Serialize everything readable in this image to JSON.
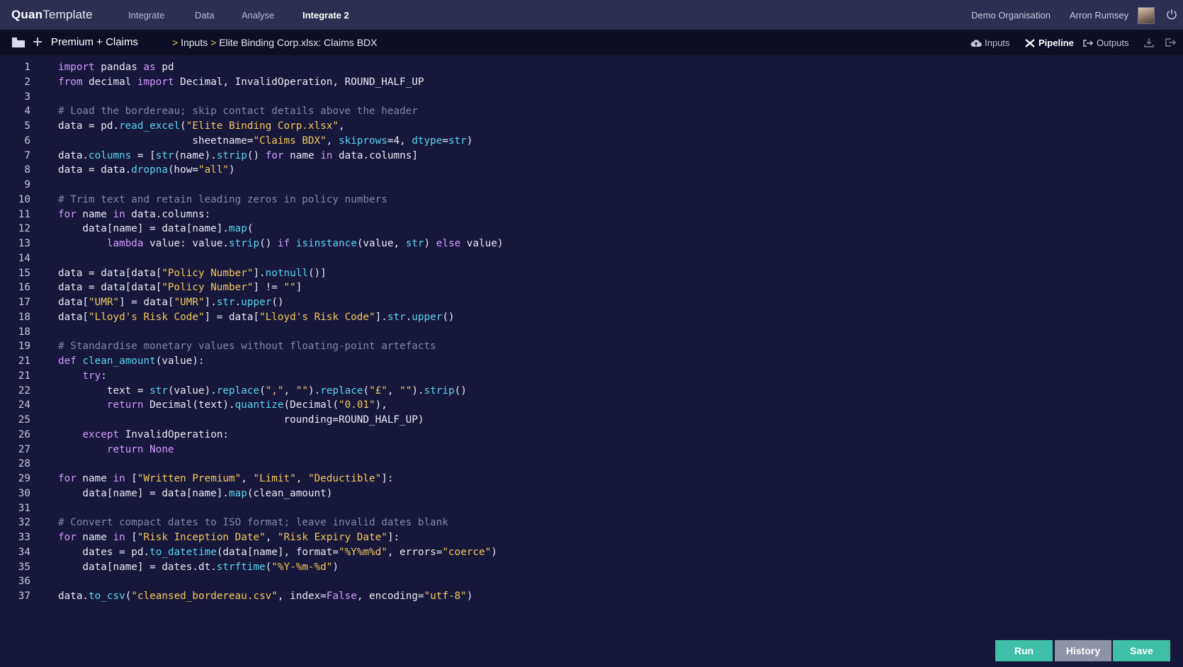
{
  "app": {
    "logo_bold": "Quan",
    "logo_light": "Template",
    "nav": [
      "Integrate",
      "Data",
      "Analyse",
      "Integrate 2"
    ],
    "active_nav": "Integrate 2",
    "organisation": "Demo Organisation",
    "user_name": "Arron Rumsey"
  },
  "subbar": {
    "project": "Premium + Claims",
    "breadcrumb": [
      "Inputs",
      "Elite Binding Corp.xlsx: Claims BDX"
    ],
    "views": [
      "Inputs",
      "Pipeline",
      "Outputs"
    ],
    "active_view": "Pipeline"
  },
  "editor": {
    "lines": [
      {
        "n": "1",
        "code": [
          [
            "kw",
            "import"
          ],
          [
            "t",
            " pandas "
          ],
          [
            "kw",
            "as"
          ],
          [
            "t",
            " pd"
          ]
        ]
      },
      {
        "n": "2",
        "code": [
          [
            "kw",
            "from"
          ],
          [
            "t",
            " decimal "
          ],
          [
            "kw",
            "import"
          ],
          [
            "t",
            " Decimal, InvalidOperation, ROUND_HALF_UP"
          ]
        ]
      },
      {
        "n": "3",
        "code": []
      },
      {
        "n": "4",
        "code": [
          [
            "cm",
            "# Load the bordereau; skip contact details above the header"
          ]
        ]
      },
      {
        "n": "5",
        "code": [
          [
            "t",
            "data = pd."
          ],
          [
            "fn",
            "read_excel"
          ],
          [
            "t",
            "("
          ],
          [
            "str",
            "\"Elite Binding Corp.xlsx\""
          ],
          [
            "t",
            ","
          ]
        ]
      },
      {
        "n": "6",
        "code": [
          [
            "t",
            "                      sheetname="
          ],
          [
            "str",
            "\"Claims BDX\""
          ],
          [
            "t",
            ", "
          ],
          [
            "fn",
            "skiprows"
          ],
          [
            "t",
            "=4, "
          ],
          [
            "fn",
            "dtype"
          ],
          [
            "t",
            "="
          ],
          [
            "fn",
            "str"
          ],
          [
            "t",
            ")"
          ]
        ]
      },
      {
        "n": "7",
        "code": [
          [
            "t",
            "data."
          ],
          [
            "fn",
            "columns"
          ],
          [
            "t",
            " = ["
          ],
          [
            "fn",
            "str"
          ],
          [
            "t",
            "(name)."
          ],
          [
            "fn",
            "strip"
          ],
          [
            "t",
            "() "
          ],
          [
            "kw",
            "for"
          ],
          [
            "t",
            " name "
          ],
          [
            "kw",
            "in"
          ],
          [
            "t",
            " data.columns]"
          ]
        ]
      },
      {
        "n": "8",
        "code": [
          [
            "t",
            "data = data."
          ],
          [
            "fn",
            "dropna"
          ],
          [
            "t",
            "(how="
          ],
          [
            "str",
            "\"all\""
          ],
          [
            "t",
            ")"
          ]
        ]
      },
      {
        "n": "9",
        "code": []
      },
      {
        "n": "10",
        "code": [
          [
            "cm",
            "# Trim text and retain leading zeros in policy numbers"
          ]
        ]
      },
      {
        "n": "11",
        "code": [
          [
            "kw",
            "for"
          ],
          [
            "t",
            " name "
          ],
          [
            "kw",
            "in"
          ],
          [
            "t",
            " data.columns:"
          ]
        ]
      },
      {
        "n": "12",
        "code": [
          [
            "t",
            "    data[name] = data[name]."
          ],
          [
            "fn",
            "map"
          ],
          [
            "t",
            "("
          ]
        ]
      },
      {
        "n": "13",
        "code": [
          [
            "t",
            "        "
          ],
          [
            "kw",
            "lambda"
          ],
          [
            "t",
            " value: value."
          ],
          [
            "fn",
            "strip"
          ],
          [
            "t",
            "() "
          ],
          [
            "kw",
            "if"
          ],
          [
            "t",
            " "
          ],
          [
            "fn",
            "isinstance"
          ],
          [
            "t",
            "(value, "
          ],
          [
            "fn",
            "str"
          ],
          [
            "t",
            ") "
          ],
          [
            "kw",
            "else"
          ],
          [
            "t",
            " value)"
          ]
        ]
      },
      {
        "n": "14",
        "code": []
      },
      {
        "n": "15",
        "code": [
          [
            "t",
            "data = data[data["
          ],
          [
            "str",
            "\"Policy Number\""
          ],
          [
            "t",
            "]."
          ],
          [
            "fn",
            "notnull"
          ],
          [
            "t",
            "()]"
          ]
        ]
      },
      {
        "n": "16",
        "code": [
          [
            "t",
            "data = data[data["
          ],
          [
            "str",
            "\"Policy Number\""
          ],
          [
            "t",
            "] != "
          ],
          [
            "str",
            "\"\""
          ],
          [
            "t",
            "]"
          ]
        ]
      },
      {
        "n": "17",
        "code": [
          [
            "t",
            "data["
          ],
          [
            "str",
            "\"UMR\""
          ],
          [
            "t",
            "] = data["
          ],
          [
            "str",
            "\"UMR\""
          ],
          [
            "t",
            "]."
          ],
          [
            "fn",
            "str"
          ],
          [
            "t",
            "."
          ],
          [
            "fn",
            "upper"
          ],
          [
            "t",
            "()"
          ]
        ]
      },
      {
        "n": "18",
        "code": [
          [
            "t",
            "data["
          ],
          [
            "str",
            "\"Lloyd's Risk Code\""
          ],
          [
            "t",
            "] = data["
          ],
          [
            "str",
            "\"Lloyd's Risk Code\""
          ],
          [
            "t",
            "]."
          ],
          [
            "fn",
            "str"
          ],
          [
            "t",
            "."
          ],
          [
            "fn",
            "upper"
          ],
          [
            "t",
            "()"
          ]
        ]
      },
      {
        "n": "18",
        "code": []
      },
      {
        "n": "19",
        "code": [
          [
            "cm",
            "# Standardise monetary values without floating-point artefacts"
          ]
        ]
      },
      {
        "n": "21",
        "code": [
          [
            "kw",
            "def"
          ],
          [
            "t",
            " "
          ],
          [
            "fn",
            "clean_amount"
          ],
          [
            "t",
            "(value):"
          ]
        ]
      },
      {
        "n": "21",
        "code": [
          [
            "t",
            "    "
          ],
          [
            "kw",
            "try"
          ],
          [
            "t",
            ":"
          ]
        ]
      },
      {
        "n": "22",
        "code": [
          [
            "t",
            "        text = "
          ],
          [
            "fn",
            "str"
          ],
          [
            "t",
            "(value)."
          ],
          [
            "fn",
            "replace"
          ],
          [
            "t",
            "("
          ],
          [
            "str",
            "\",\""
          ],
          [
            "t",
            ", "
          ],
          [
            "str",
            "\"\""
          ],
          [
            "t",
            ")."
          ],
          [
            "fn",
            "replace"
          ],
          [
            "t",
            "("
          ],
          [
            "str",
            "\"£\""
          ],
          [
            "t",
            ", "
          ],
          [
            "str",
            "\"\""
          ],
          [
            "t",
            ")."
          ],
          [
            "fn",
            "strip"
          ],
          [
            "t",
            "()"
          ]
        ]
      },
      {
        "n": "24",
        "code": [
          [
            "t",
            "        "
          ],
          [
            "kw",
            "return"
          ],
          [
            "t",
            " Decimal(text)."
          ],
          [
            "fn",
            "quantize"
          ],
          [
            "t",
            "(Decimal("
          ],
          [
            "str",
            "\"0.01\""
          ],
          [
            "t",
            "),"
          ]
        ]
      },
      {
        "n": "25",
        "code": [
          [
            "t",
            "                                     rounding=ROUND_HALF_UP)"
          ]
        ]
      },
      {
        "n": "26",
        "code": [
          [
            "t",
            "    "
          ],
          [
            "kw",
            "except"
          ],
          [
            "t",
            " InvalidOperation:"
          ]
        ]
      },
      {
        "n": "27",
        "code": [
          [
            "t",
            "        "
          ],
          [
            "kw",
            "return"
          ],
          [
            "t",
            " "
          ],
          [
            "kw",
            "None"
          ]
        ]
      },
      {
        "n": "28",
        "code": []
      },
      {
        "n": "29",
        "code": [
          [
            "kw",
            "for"
          ],
          [
            "t",
            " name "
          ],
          [
            "kw",
            "in"
          ],
          [
            "t",
            " ["
          ],
          [
            "str",
            "\"Written Premium\""
          ],
          [
            "t",
            ", "
          ],
          [
            "str",
            "\"Limit\""
          ],
          [
            "t",
            ", "
          ],
          [
            "str",
            "\"Deductible\""
          ],
          [
            "t",
            "]:"
          ]
        ]
      },
      {
        "n": "30",
        "code": [
          [
            "t",
            "    data[name] = data[name]."
          ],
          [
            "fn",
            "map"
          ],
          [
            "t",
            "(clean_amount)"
          ]
        ]
      },
      {
        "n": "31",
        "code": []
      },
      {
        "n": "32",
        "code": [
          [
            "cm",
            "# Convert compact dates to ISO format; leave invalid dates blank"
          ]
        ]
      },
      {
        "n": "33",
        "code": [
          [
            "kw",
            "for"
          ],
          [
            "t",
            " name "
          ],
          [
            "kw",
            "in"
          ],
          [
            "t",
            " ["
          ],
          [
            "str",
            "\"Risk Inception Date\""
          ],
          [
            "t",
            ", "
          ],
          [
            "str",
            "\"Risk Expiry Date\""
          ],
          [
            "t",
            "]:"
          ]
        ]
      },
      {
        "n": "34",
        "code": [
          [
            "t",
            "    dates = pd."
          ],
          [
            "fn",
            "to_datetime"
          ],
          [
            "t",
            "(data[name], format="
          ],
          [
            "str",
            "\"%Y%m%d\""
          ],
          [
            "t",
            ", errors="
          ],
          [
            "str",
            "\"coerce\""
          ],
          [
            "t",
            ")"
          ]
        ]
      },
      {
        "n": "35",
        "code": [
          [
            "t",
            "    data[name] = dates.dt."
          ],
          [
            "fn",
            "strftime"
          ],
          [
            "t",
            "("
          ],
          [
            "str",
            "\"%Y-%m-%d\""
          ],
          [
            "t",
            ")"
          ]
        ]
      },
      {
        "n": "36",
        "code": []
      },
      {
        "n": "37",
        "code": [
          [
            "t",
            "data."
          ],
          [
            "fn",
            "to_csv"
          ],
          [
            "t",
            "("
          ],
          [
            "str",
            "\"cleansed_bordereau.csv\""
          ],
          [
            "t",
            ", index="
          ],
          [
            "kw",
            "False"
          ],
          [
            "t",
            ", encoding="
          ],
          [
            "str",
            "\"utf-8\""
          ],
          [
            "t",
            ")"
          ]
        ]
      }
    ]
  },
  "actions": {
    "run": "Run",
    "history": "History",
    "save": "Save"
  },
  "colors": {
    "accent": "#3fbfa8",
    "navbar": "#2c2e52",
    "background": "#16173a"
  }
}
